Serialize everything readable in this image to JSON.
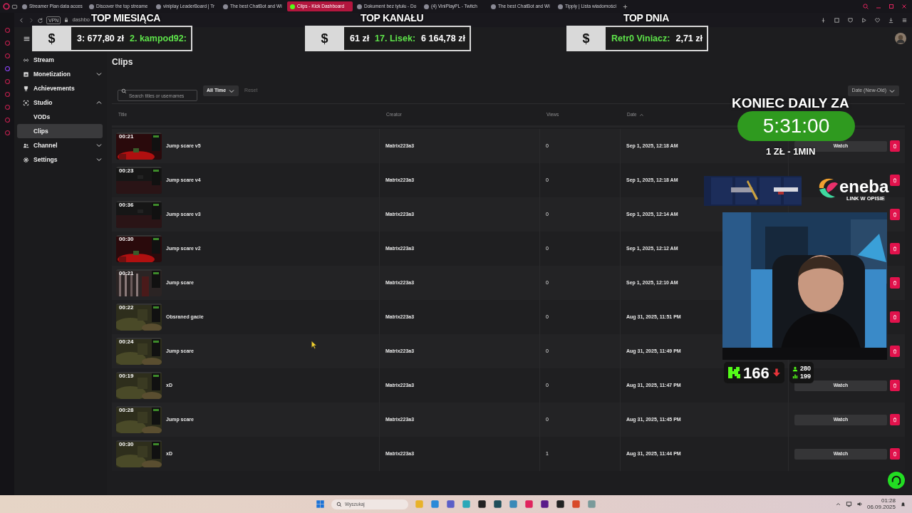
{
  "browser": {
    "tabs": [
      {
        "label": "Streamer Plan data acces",
        "selected": false
      },
      {
        "label": "Discover the top streame",
        "selected": false
      },
      {
        "label": "viniplay LeaderBoard | Tr",
        "selected": false
      },
      {
        "label": "The best ChatBot and Wi",
        "selected": false
      },
      {
        "label": "Clips - Kick Dashboard",
        "selected": true
      },
      {
        "label": "Dokument bez tytułu - Do",
        "selected": false
      },
      {
        "label": "(4) ViniPlayPL - Twitch",
        "selected": false
      },
      {
        "label": "The best ChatBot and Wi",
        "selected": false
      },
      {
        "label": "Tipply | Lista wiadomości",
        "selected": false
      }
    ],
    "vpn_badge": "VPN",
    "address": "dashbo"
  },
  "sidebar": {
    "items": [
      {
        "label": "Stream",
        "selected": false
      },
      {
        "label": "Monetization",
        "selected": false,
        "expanded": false
      },
      {
        "label": "Achievements",
        "selected": false
      },
      {
        "label": "Studio",
        "selected": false,
        "expanded": true,
        "children": [
          {
            "label": "VODs",
            "selected": false
          },
          {
            "label": "Clips",
            "selected": true
          }
        ]
      },
      {
        "label": "Channel",
        "selected": false,
        "expanded": false
      },
      {
        "label": "Settings",
        "selected": false,
        "expanded": false
      }
    ]
  },
  "page": {
    "title": "Clips",
    "search": {
      "placeholder": "Search titles or usernames"
    },
    "time_filter": "All Time",
    "reset": {
      "label": "Reset",
      "disabled": true
    },
    "sort": "Date (New-Old)"
  },
  "table": {
    "columns": [
      {
        "label": "Title",
        "sorted": false
      },
      {
        "label": "Creator",
        "sorted": false
      },
      {
        "label": "Views",
        "sorted": false
      },
      {
        "label": "Date",
        "sorted": true
      }
    ],
    "rows": [
      {
        "duration": "00:21",
        "title": "Jump scare v5",
        "creator": "Matrix223a3",
        "views": "0",
        "date": "Sep 1, 2025, 12:18 AM",
        "watch": "Watch"
      },
      {
        "duration": "00:23",
        "title": "Jump scare v4",
        "creator": "Matrix223a3",
        "views": "0",
        "date": "Sep 1, 2025, 12:18 AM"
      },
      {
        "duration": "00:36",
        "title": "Jump scare v3",
        "creator": "Matrix223a3",
        "views": "0",
        "date": "Sep 1, 2025, 12:14 AM"
      },
      {
        "duration": "00:30",
        "title": "Jump scare v2",
        "creator": "Matrix223a3",
        "views": "0",
        "date": "Sep 1, 2025, 12:12 AM"
      },
      {
        "duration": "00:21",
        "title": "Jump scare",
        "creator": "Matrix223a3",
        "views": "0",
        "date": "Sep 1, 2025, 12:10 AM"
      },
      {
        "duration": "00:22",
        "title": "Obsrаned gacie",
        "creator": "Matrix223a3",
        "views": "0",
        "date": "Aug 31, 2025, 11:51 PM"
      },
      {
        "duration": "00:24",
        "title": "Jump scare",
        "creator": "Matrix223a3",
        "views": "0",
        "date": "Aug 31, 2025, 11:49 PM"
      },
      {
        "duration": "00:19",
        "title": "xD",
        "creator": "Matrix223a3",
        "views": "0",
        "date": "Aug 31, 2025, 11:47 PM",
        "watch": "Watch"
      },
      {
        "duration": "00:28",
        "title": "Jump scare",
        "creator": "Matrix223a3",
        "views": "0",
        "date": "Aug 31, 2025, 11:45 PM",
        "watch": "Watch"
      },
      {
        "duration": "00:30",
        "title": "xD",
        "creator": "Matrix223a3",
        "views": "1",
        "date": "Aug 31, 2025, 11:44 PM",
        "watch": "Watch"
      }
    ]
  },
  "stream_overlay": {
    "tickers": [
      {
        "heading": "TOP MIESIĄCA",
        "symbol": "$",
        "segments": [
          {
            "text": "3: 677,80 zł",
            "kind": "amount"
          },
          {
            "text": "2. kampod92:",
            "kind": "name"
          }
        ]
      },
      {
        "heading": "TOP KANAŁU",
        "symbol": "$",
        "segments": [
          {
            "text": "61 zł",
            "kind": "amount"
          },
          {
            "text": "17. Lisek:",
            "kind": "name"
          },
          {
            "text": "6 164,78 zł",
            "kind": "amount"
          }
        ]
      },
      {
        "heading": "TOP DNIA",
        "symbol": "$",
        "segments": [
          {
            "text": "Retr0 Viniacz:",
            "kind": "name"
          },
          {
            "text": "2,71 zł",
            "kind": "amount"
          }
        ]
      }
    ],
    "timer": {
      "heading": "KONIEC DAILY ZA",
      "time": "5:31:00",
      "rate": "1 ZŁ - 1MIN"
    },
    "sponsor": {
      "name": "eneba",
      "note": "LINK W OPISIE"
    },
    "viewers": {
      "count": "166",
      "followers": "280",
      "subs": "199"
    }
  },
  "taskbar": {
    "search_placeholder": "Wyszukaj",
    "time": "01:28",
    "date": "06.09.2025"
  }
}
